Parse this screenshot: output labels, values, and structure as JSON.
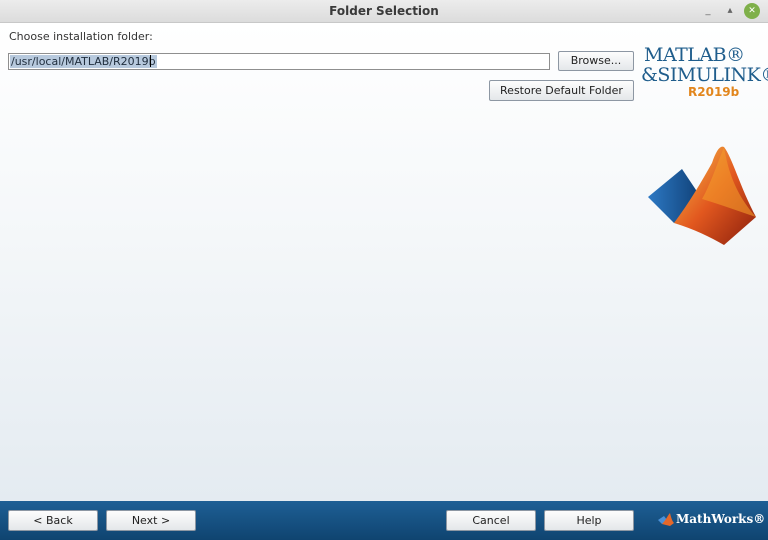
{
  "window": {
    "title": "Folder Selection",
    "minimize": "_",
    "maximize": "▴",
    "close": "✕"
  },
  "main": {
    "prompt": "Choose installation folder:",
    "path_value": "/usr/local/MATLAB/R2019b",
    "browse_label": "Browse...",
    "restore_label": "Restore Default Folder"
  },
  "logo": {
    "line1": "MATLAB®",
    "line2": "&SIMULINK®",
    "release": "R2019b"
  },
  "footer": {
    "back_label": "< Back",
    "next_label": "Next >",
    "cancel_label": "Cancel",
    "help_label": "Help",
    "brand": "MathWorks®"
  },
  "colors": {
    "accent": "#1e5f95",
    "logo_text": "#1f5d8c",
    "release": "#e2861d"
  }
}
